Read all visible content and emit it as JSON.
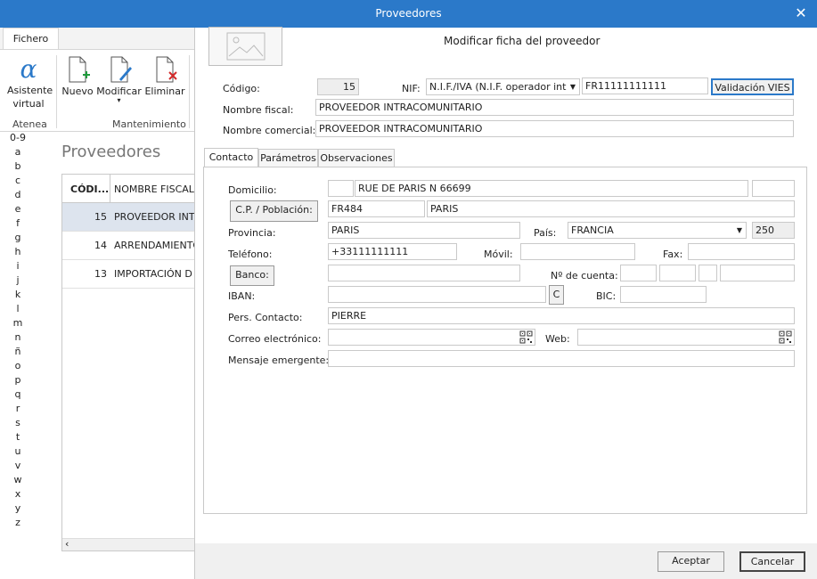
{
  "window": {
    "title": "Proveedores"
  },
  "ribbon": {
    "tab": "Fichero",
    "buttons": {
      "asistente": "Asistente virtual",
      "nuevo": "Nuevo",
      "modificar": "Modificar",
      "eliminar": "Eliminar"
    },
    "groups": {
      "atenea": "Atenea",
      "mantenimiento": "Mantenimiento"
    }
  },
  "alphabet": [
    "0-9",
    "a",
    "b",
    "c",
    "d",
    "e",
    "f",
    "g",
    "h",
    "i",
    "j",
    "k",
    "l",
    "m",
    "n",
    "ñ",
    "o",
    "p",
    "q",
    "r",
    "s",
    "t",
    "u",
    "v",
    "w",
    "x",
    "y",
    "z"
  ],
  "list": {
    "title": "Proveedores",
    "columns": {
      "code": "CÓDI...",
      "name": "NOMBRE FISCAL"
    },
    "rows": [
      {
        "code": "15",
        "name": "PROVEEDOR INTR"
      },
      {
        "code": "14",
        "name": "ARRENDAMIENTO"
      },
      {
        "code": "13",
        "name": "IMPORTACIÓN D"
      }
    ]
  },
  "dialog": {
    "title": "Modificar ficha del proveedor",
    "codigo_label": "Código:",
    "codigo": "15",
    "nif_label": "NIF:",
    "nif_type": "N.I.F./IVA (N.I.F. operador int",
    "nif_value": "FR11111111111",
    "vies_button": "Validación VIES",
    "nombre_fiscal_label": "Nombre fiscal:",
    "nombre_fiscal": "PROVEEDOR INTRACOMUNITARIO",
    "nombre_comercial_label": "Nombre comercial:",
    "nombre_comercial": "PROVEEDOR INTRACOMUNITARIO",
    "tabs": [
      "Contacto",
      "Parámetros",
      "Observaciones"
    ],
    "contacto": {
      "domicilio_label": "Domicilio:",
      "domicilio": "RUE DE PARIS N 66699",
      "cp_button": "C.P. / Población:",
      "cp": "FR484",
      "poblacion": "PARIS",
      "provincia_label": "Provincia:",
      "provincia": "PARIS",
      "pais_label": "País:",
      "pais": "FRANCIA",
      "pais_code": "250",
      "telefono_label": "Teléfono:",
      "telefono": "+33111111111",
      "movil_label": "Móvil:",
      "fax_label": "Fax:",
      "banco_button": "Banco:",
      "cuenta_label": "Nº de cuenta:",
      "iban_label": "IBAN:",
      "iban_c_button": "C",
      "bic_label": "BIC:",
      "contacto_label": "Pers. Contacto:",
      "contacto": "PIERRE",
      "correo_label": "Correo electrónico:",
      "web_label": "Web:",
      "mensaje_label": "Mensaje emergente:"
    },
    "footer": {
      "aceptar": "Aceptar",
      "cancelar": "Cancelar"
    }
  }
}
